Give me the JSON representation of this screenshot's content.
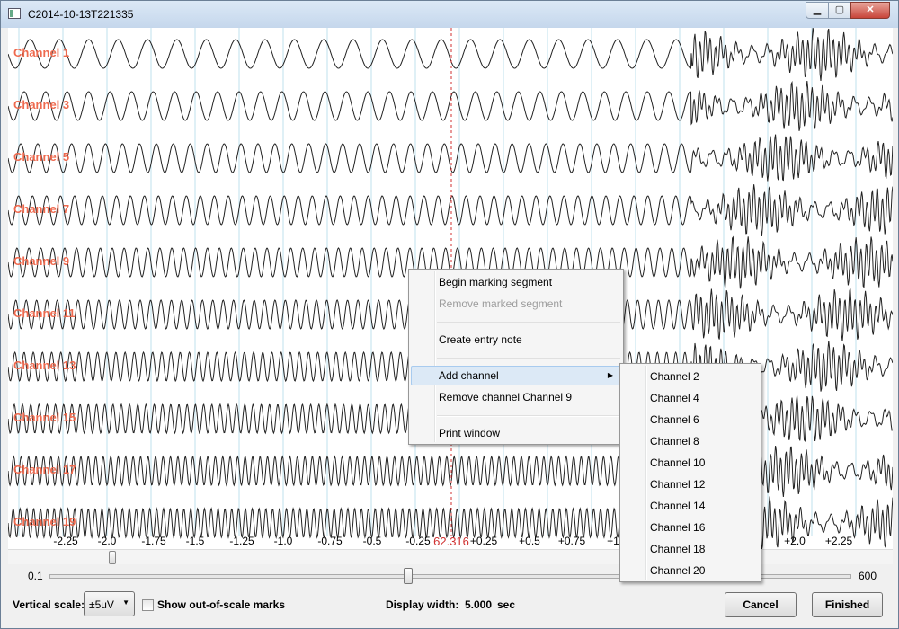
{
  "window": {
    "title": "C2014-10-13T221335"
  },
  "channels": [
    "Channel 1",
    "Channel 3",
    "Channel 5",
    "Channel 7",
    "Channel 9",
    "Channel 11",
    "Channel 13",
    "Channel 15",
    "Channel 17",
    "Channel 19"
  ],
  "time_axis": {
    "ticks": [
      "-2.25",
      "-2.0",
      "-1.75",
      "-1.5",
      "-1.25",
      "-1.0",
      "-0.75",
      "-0.5",
      "-0.25",
      "+0.25",
      "+0.5",
      "+0.75",
      "+1.0",
      "+2.0",
      "+2.25"
    ],
    "cursor_label": "62.316"
  },
  "width_slider": {
    "min_label": "0.1",
    "max_label": "600",
    "value": 0.45
  },
  "footer": {
    "vertical_scale_label": "Vertical scale:",
    "vertical_scale_value": "±5uV",
    "show_out_of_scale_label": "Show out-of-scale marks",
    "show_out_of_scale_checked": false,
    "display_width_label": "Display width:",
    "display_width_value": "5.000",
    "display_width_unit": "sec",
    "cancel_label": "Cancel",
    "finished_label": "Finished"
  },
  "context_menu": {
    "begin_marking": "Begin marking segment",
    "remove_marked": "Remove marked segment",
    "create_note": "Create entry note",
    "add_channel": "Add channel",
    "remove_channel": "Remove channel Channel 9",
    "print_window": "Print window"
  },
  "add_channel_submenu": [
    "Channel 2",
    "Channel 4",
    "Channel 6",
    "Channel 8",
    "Channel 10",
    "Channel 12",
    "Channel 14",
    "Channel 16",
    "Channel 18",
    "Channel 20"
  ],
  "colors": {
    "channel_label": "#ee6a4f",
    "cursor": "#d03030",
    "grid": "#bfe0ee"
  }
}
